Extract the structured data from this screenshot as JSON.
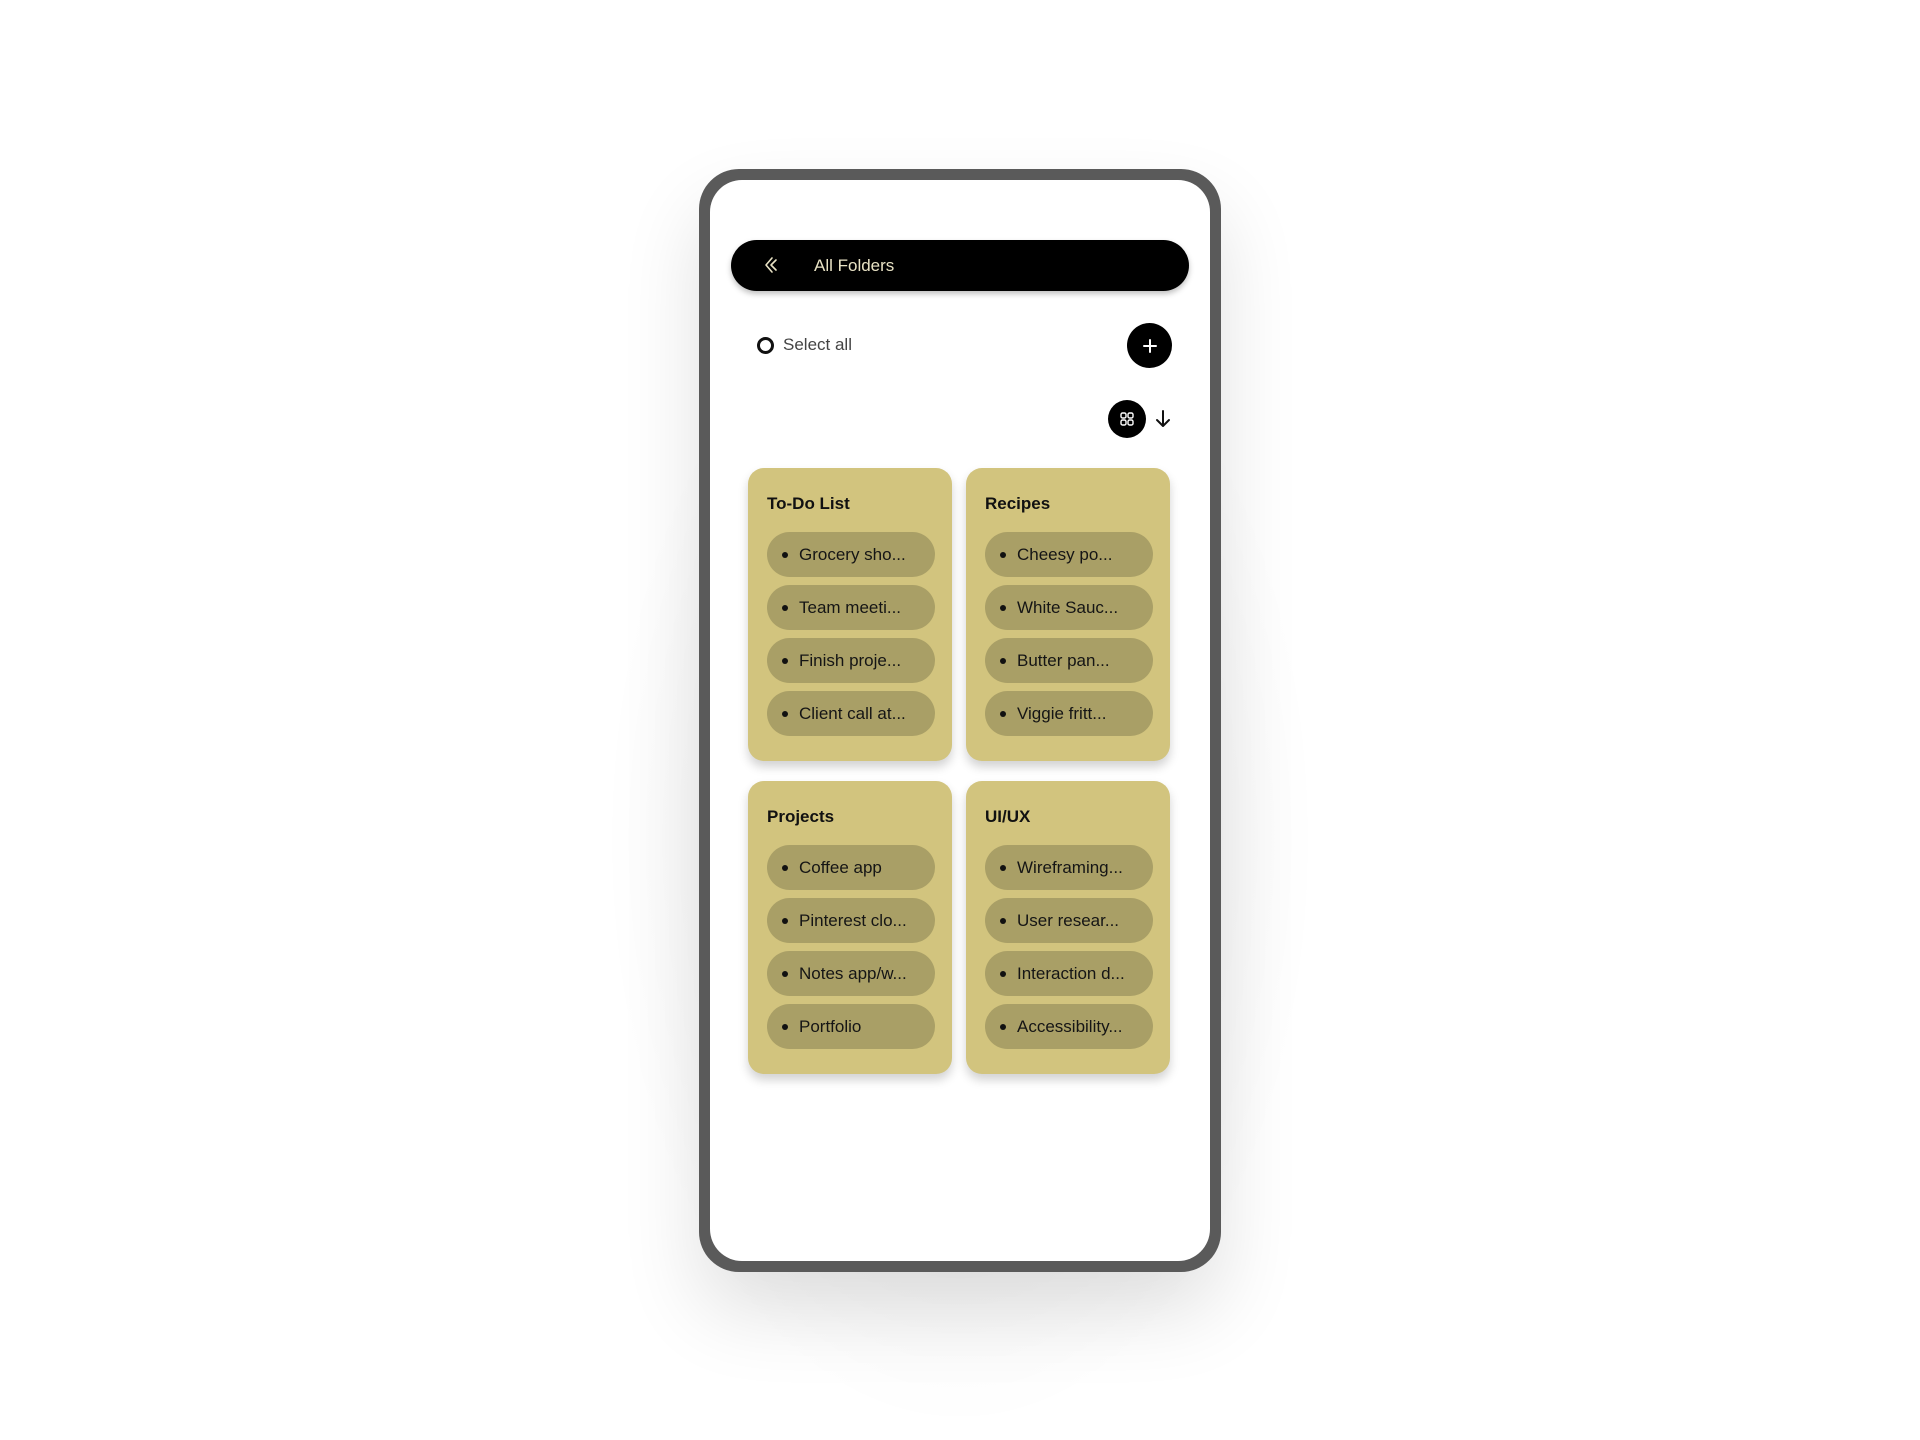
{
  "header": {
    "title": "All Folders",
    "back_icon": "chevron-left-icon"
  },
  "toolbar": {
    "select_all_label": "Select all",
    "add_icon": "plus-icon",
    "view_icon": "grid-view-icon",
    "sort_icon": "arrow-down-icon"
  },
  "colors": {
    "card_background": "#d2c47e",
    "pill_background": "#a99f66",
    "header_background": "#000000",
    "header_text": "#e8e2c4"
  },
  "folders": [
    {
      "title": "To-Do List",
      "notes": [
        "Grocery sho...",
        "Team meeti...",
        "Finish proje...",
        "Client call at..."
      ]
    },
    {
      "title": "Recipes",
      "notes": [
        "Cheesy po...",
        "White Sauc...",
        "Butter pan...",
        "Viggie fritt..."
      ]
    },
    {
      "title": "Projects",
      "notes": [
        "Coffee app",
        "Pinterest clo...",
        "Notes app/w...",
        "Portfolio"
      ]
    },
    {
      "title": "UI/UX",
      "notes": [
        "Wireframing...",
        "User resear...",
        "Interaction d...",
        "Accessibility..."
      ]
    }
  ]
}
